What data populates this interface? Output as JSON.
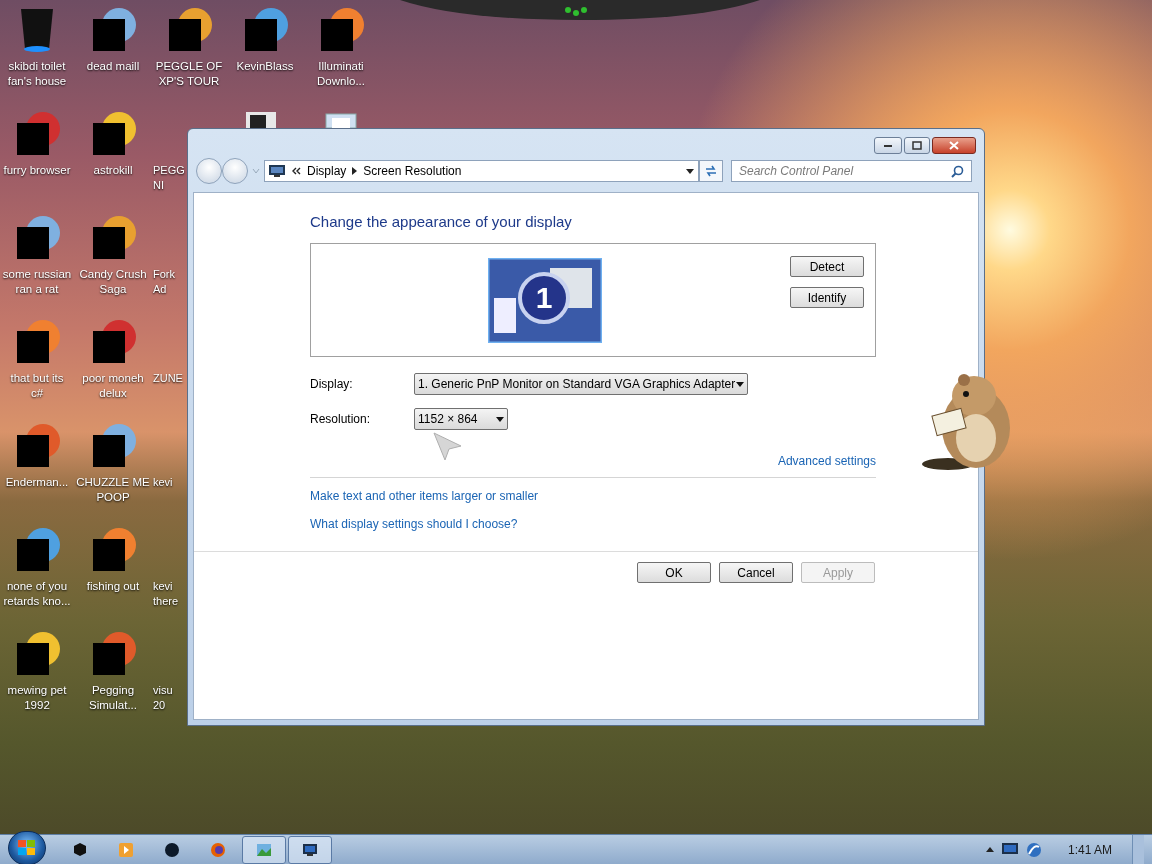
{
  "desktop_icons": [
    {
      "label": "skibdi toilet\nfan's house",
      "kind": "bin"
    },
    {
      "label": "dead maill",
      "kind": "app"
    },
    {
      "label": "PEGGLE OF\nXP'S TOUR",
      "kind": "app"
    },
    {
      "label": "KevinBlass",
      "kind": "app"
    },
    {
      "label": "Illuminati\nDownlo...",
      "kind": "app"
    },
    {
      "label": "furry browser",
      "kind": "app"
    },
    {
      "label": "astrokill",
      "kind": "app"
    },
    {
      "label": "PEGG\nNI",
      "kind": "clipped"
    },
    {
      "label": "some russian\nran a rat",
      "kind": "app"
    },
    {
      "label": "Candy Crush\nSaga",
      "kind": "app"
    },
    {
      "label": "Fork\nAd",
      "kind": "clipped"
    },
    {
      "label": "that but its\nc#",
      "kind": "app"
    },
    {
      "label": "poor moneh\ndelux",
      "kind": "app"
    },
    {
      "label": "ZUNE",
      "kind": "clipped"
    },
    {
      "label": "Enderman...",
      "kind": "app"
    },
    {
      "label": "CHUZZLE ME\nPOOP",
      "kind": "app"
    },
    {
      "label": "kevi",
      "kind": "clipped"
    },
    {
      "label": "none of you\nretards kno...",
      "kind": "app"
    },
    {
      "label": "fishing out",
      "kind": "app"
    },
    {
      "label": "kevi\nthere",
      "kind": "clipped"
    },
    {
      "label": "mewing pet\n1992",
      "kind": "app"
    },
    {
      "label": "Pegging\nSimulat...",
      "kind": "app"
    },
    {
      "label": "visu\n20",
      "kind": "clipped"
    }
  ],
  "window": {
    "breadcrumbs": [
      "Display",
      "Screen Resolution"
    ],
    "search": {
      "placeholder": "Search Control Panel"
    },
    "heading": "Change the appearance of your display",
    "monitor_number": "1",
    "side_buttons": [
      "Detect",
      "Identify"
    ],
    "fields": [
      {
        "label": "Display:",
        "value": "1. Generic PnP Monitor on Standard VGA Graphics Adapter",
        "kind": "wide"
      },
      {
        "label": "Resolution:",
        "value": "1152 × 864",
        "kind": "narrow"
      }
    ],
    "advanced_link": "Advanced settings",
    "links": [
      "Make text and other items larger or smaller",
      "What display settings should I choose?"
    ],
    "buttons": [
      {
        "label": "OK",
        "disabled": false
      },
      {
        "label": "Cancel",
        "disabled": false
      },
      {
        "label": "Apply",
        "disabled": true
      }
    ]
  },
  "taskbar": {
    "items": [
      {
        "kind": "cube",
        "active": false
      },
      {
        "kind": "media",
        "active": false
      },
      {
        "kind": "orb",
        "active": false
      },
      {
        "kind": "firefox",
        "active": false
      },
      {
        "kind": "pictures",
        "active": true
      },
      {
        "kind": "display",
        "active": true
      }
    ],
    "clock": "1:41 AM"
  }
}
